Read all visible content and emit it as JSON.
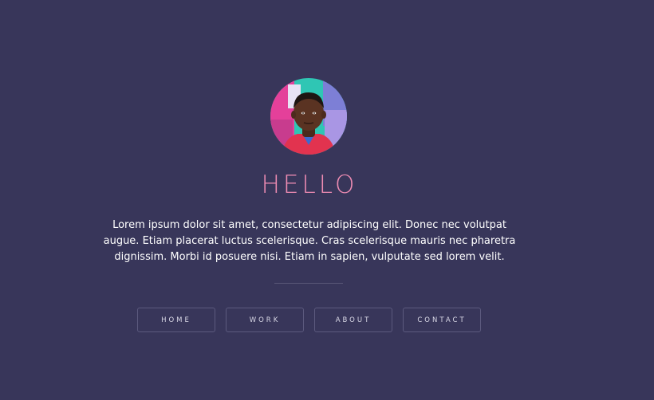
{
  "profile": {
    "greeting": "HELLO",
    "intro": "Lorem ipsum dolor sit amet, consectetur adipiscing elit. Donec nec volutpat augue. Etiam placerat luctus scelerisque. Cras scelerisque mauris nec pharetra dignissim. Morbi id posuere nisi. Etiam in sapien, vulputate sed lorem velit."
  },
  "nav": {
    "home": "HOME",
    "work": "WORK",
    "about": "ABOUT",
    "contact": "CONTACT"
  },
  "colors": {
    "background": "#38365a",
    "accent": "#f08db4",
    "text": "#ffffff"
  }
}
